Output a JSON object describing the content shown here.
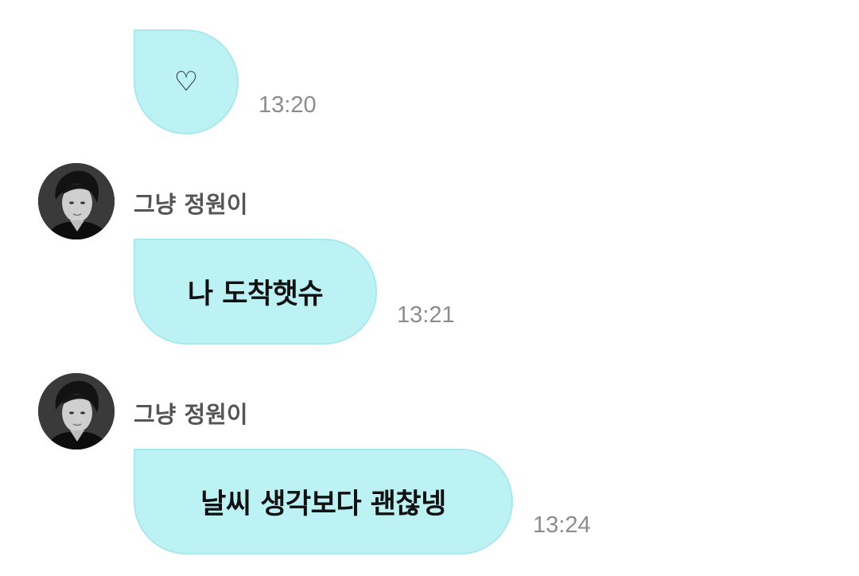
{
  "messages": [
    {
      "id": "m1",
      "text": "♡",
      "time": "13:20"
    },
    {
      "id": "m2",
      "sender": "그냥 정원이",
      "text": "나 도착햇슈",
      "time": "13:21"
    },
    {
      "id": "m3",
      "sender": "그냥 정원이",
      "text": "날씨 생각보다 괜찮넹",
      "time": "13:24"
    }
  ],
  "colors": {
    "bubble": "#bdf2f5",
    "bubble_border": "#a8e8ee",
    "time": "#8c8c8c",
    "sender": "#555555"
  }
}
